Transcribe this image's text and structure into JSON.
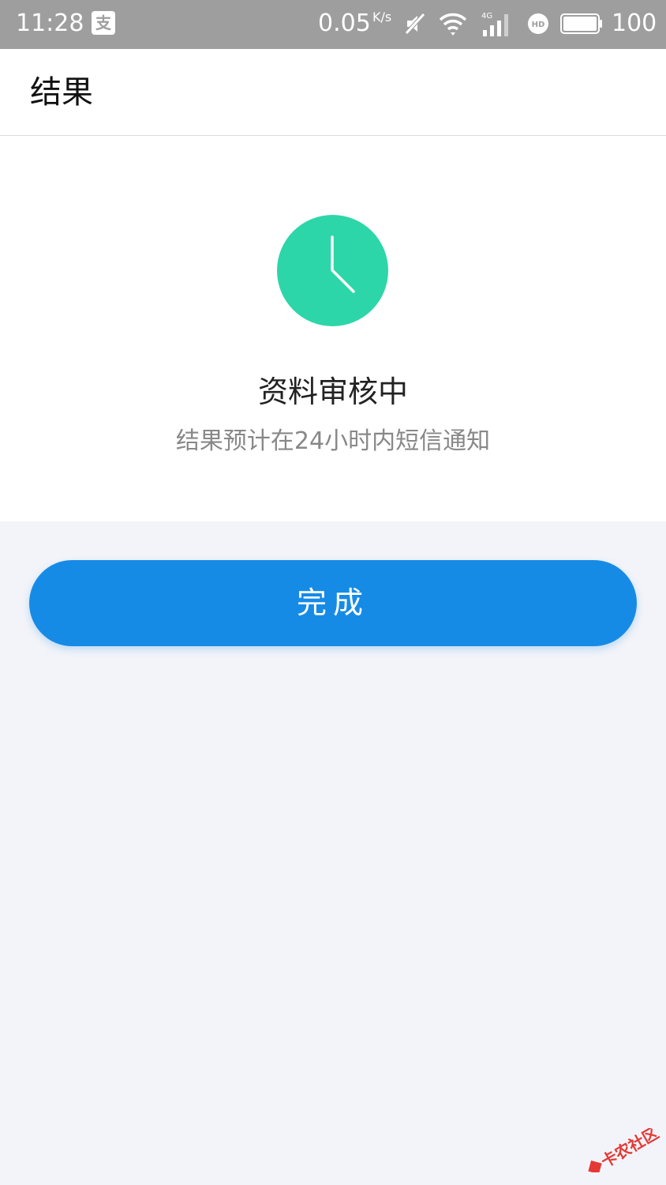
{
  "status_bar": {
    "time": "11:28",
    "alipay_icon": "支",
    "speed": "0.05",
    "speed_unit": "K/s",
    "battery": "100"
  },
  "header": {
    "title": "结果"
  },
  "result": {
    "icon": "clock-icon",
    "icon_color": "#2dd6a8",
    "title": "资料审核中",
    "description": "结果预计在24小时内短信通知"
  },
  "actions": {
    "done_label": "完成",
    "done_color": "#168be6"
  },
  "watermark": {
    "text": "卡农社区"
  }
}
